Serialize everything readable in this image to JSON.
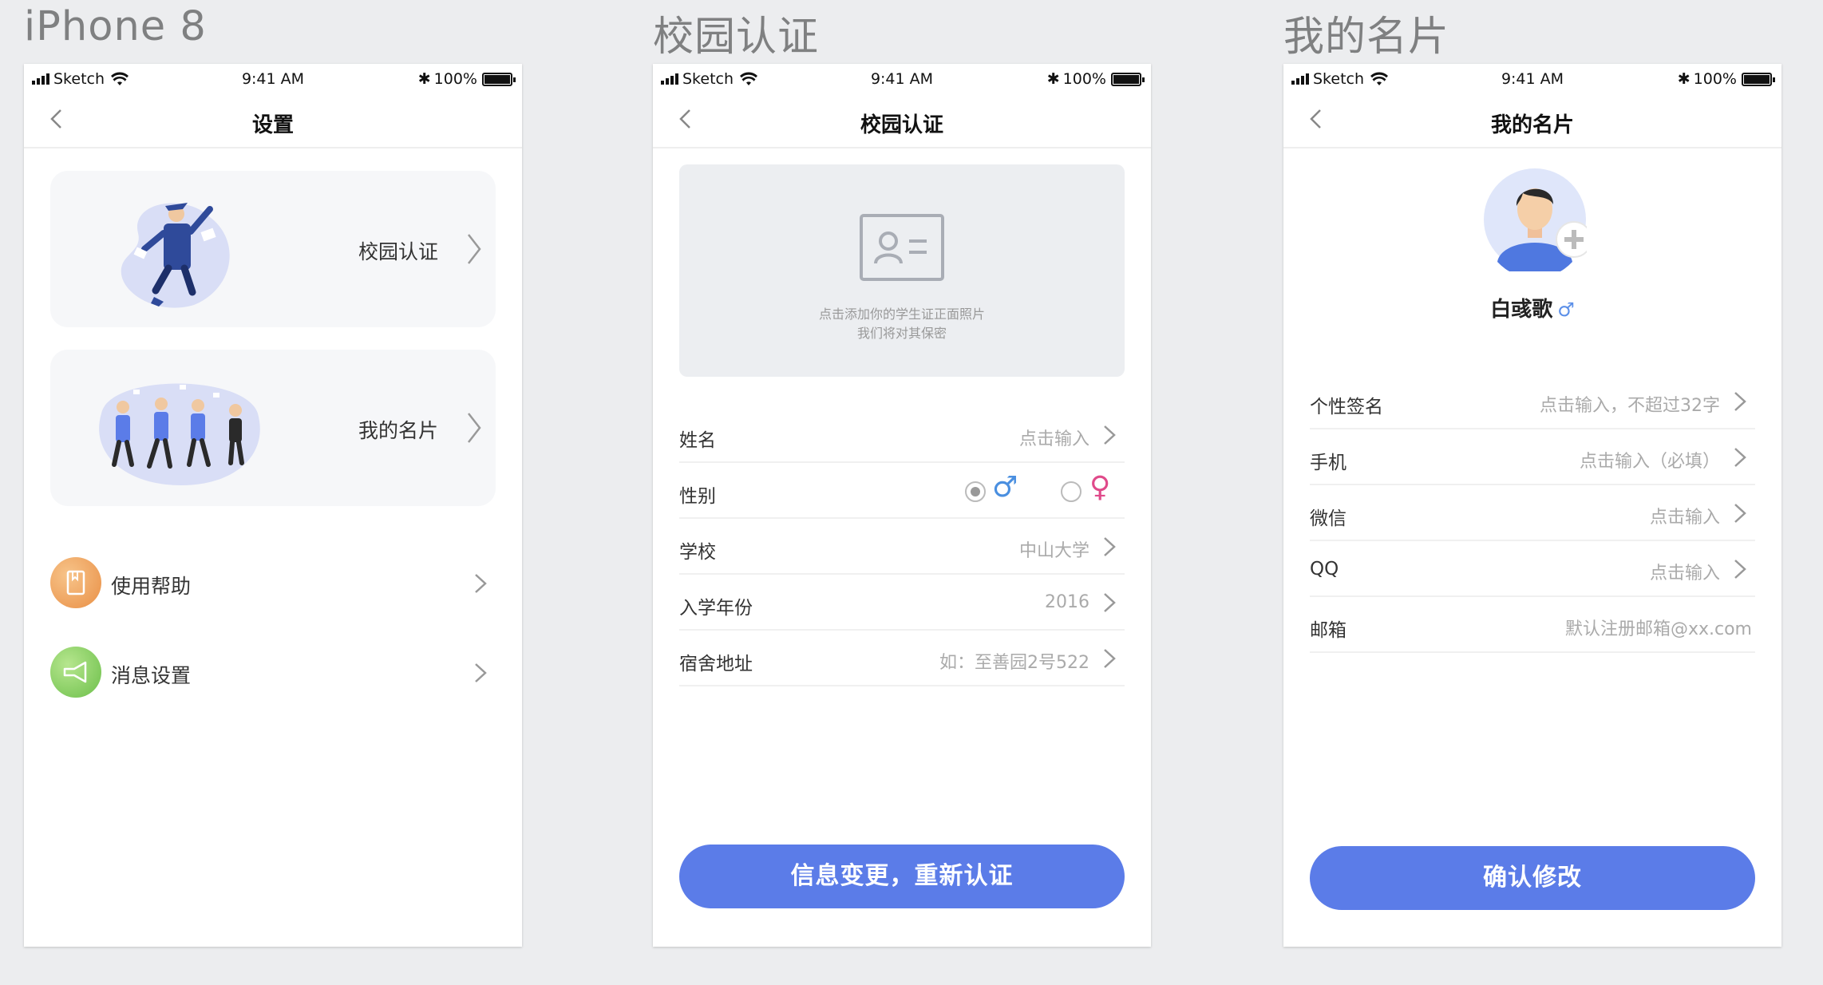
{
  "labels": {
    "col1": "iPhone 8",
    "col2": "校园认证",
    "col3": "我的名片"
  },
  "status": {
    "carrier": "Sketch",
    "time": "9:41 AM",
    "battery": "100%"
  },
  "settings": {
    "title": "设置",
    "cards": [
      {
        "label": "校园认证"
      },
      {
        "label": "我的名片"
      }
    ],
    "menu": [
      {
        "label": "使用帮助",
        "icon": "book-icon",
        "color": "#f0a35c"
      },
      {
        "label": "消息设置",
        "icon": "megaphone-icon",
        "color": "#7dc85a"
      }
    ]
  },
  "campus": {
    "title": "校园认证",
    "upload_hint_1": "点击添加你的学生证正面照片",
    "upload_hint_2": "我们将对其保密",
    "rows": [
      {
        "key": "姓名",
        "value": "点击输入"
      },
      {
        "key": "性别",
        "male": "♂",
        "female": "♀",
        "selected": "male"
      },
      {
        "key": "学校",
        "value": "中山大学"
      },
      {
        "key": "入学年份",
        "value": "2016"
      },
      {
        "key": "宿舍地址",
        "value": "如：至善园2号522"
      }
    ],
    "button": "信息变更，重新认证"
  },
  "card": {
    "title": "我的名片",
    "name": "白彧歌",
    "gender_symbol": "♂",
    "rows": [
      {
        "key": "个性签名",
        "value": "点击输入，不超过32字"
      },
      {
        "key": "手机",
        "value": "点击输入（必填）"
      },
      {
        "key": "微信",
        "value": "点击输入"
      },
      {
        "key": "QQ",
        "value": "点击输入"
      },
      {
        "key": "邮箱",
        "value": "默认注册邮箱@xx.com"
      }
    ],
    "button": "确认修改"
  }
}
